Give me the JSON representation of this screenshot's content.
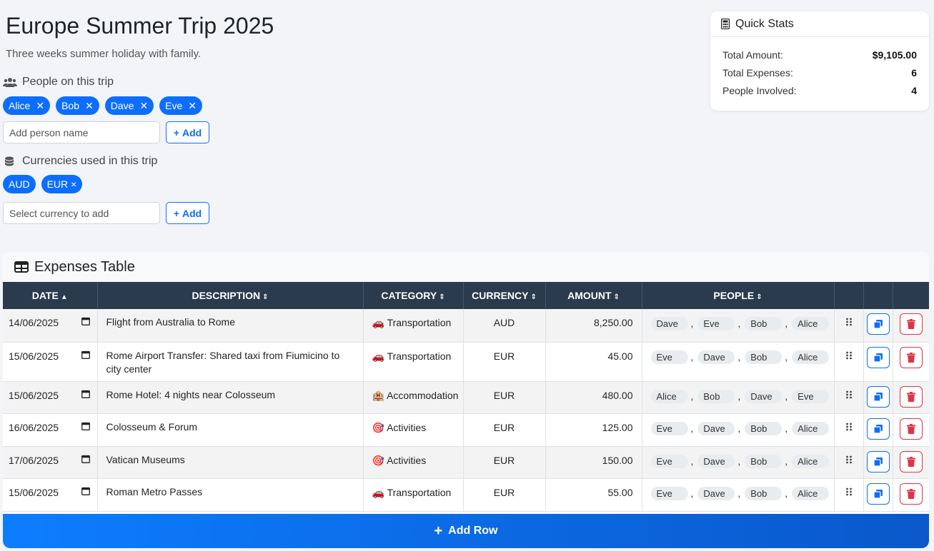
{
  "trip": {
    "title": "Europe Summer Trip 2025",
    "subtitle": "Three weeks summer holiday with family."
  },
  "people_section": {
    "label": "People on this trip",
    "people": [
      "Alice",
      "Bob",
      "Dave",
      "Eve"
    ],
    "input_placeholder": "Add person name",
    "add_label": "Add"
  },
  "currency_section": {
    "label": "Currencies used in this trip",
    "currencies": [
      "AUD",
      "EUR"
    ],
    "input_placeholder": "Select currency to add",
    "add_label": "Add"
  },
  "stats": {
    "title": "Quick Stats",
    "rows": [
      {
        "label": "Total Amount:",
        "value": "$9,105.00"
      },
      {
        "label": "Total Expenses:",
        "value": "6"
      },
      {
        "label": "People Involved:",
        "value": "4"
      }
    ]
  },
  "table": {
    "title": "Expenses Table",
    "headers": {
      "date": "DATE",
      "description": "DESCRIPTION",
      "category": "CATEGORY",
      "currency": "CURRENCY",
      "amount": "AMOUNT",
      "people": "PEOPLE"
    },
    "rows": [
      {
        "date": "14/06/2025",
        "description": "Flight from Australia to Rome",
        "category_icon": "🚗",
        "category": "Transportation",
        "currency": "AUD",
        "amount": "8,250.00",
        "people": [
          "Dave",
          "Eve",
          "Bob",
          "Alice"
        ]
      },
      {
        "date": "15/06/2025",
        "description": "Rome Airport Transfer: Shared taxi from Fiumicino to city center",
        "category_icon": "🚗",
        "category": "Transportation",
        "currency": "EUR",
        "amount": "45.00",
        "people": [
          "Eve",
          "Dave",
          "Bob",
          "Alice"
        ]
      },
      {
        "date": "15/06/2025",
        "description": "Rome Hotel: 4 nights near Colosseum",
        "category_icon": "🏨",
        "category": "Accommodation",
        "currency": "EUR",
        "amount": "480.00",
        "people": [
          "Alice",
          "Bob",
          "Dave",
          "Eve"
        ]
      },
      {
        "date": "16/06/2025",
        "description": "Colosseum & Forum",
        "category_icon": "🎯",
        "category": "Activities",
        "currency": "EUR",
        "amount": "125.00",
        "people": [
          "Eve",
          "Dave",
          "Bob",
          "Alice"
        ]
      },
      {
        "date": "17/06/2025",
        "description": "Vatican Museums",
        "category_icon": "🎯",
        "category": "Activities",
        "currency": "EUR",
        "amount": "150.00",
        "people": [
          "Eve",
          "Dave",
          "Bob",
          "Alice"
        ]
      },
      {
        "date": "15/06/2025",
        "description": "Roman Metro Passes",
        "category_icon": "🚗",
        "category": "Transportation",
        "currency": "EUR",
        "amount": "55.00",
        "people": [
          "Eve",
          "Dave",
          "Bob",
          "Alice"
        ]
      }
    ],
    "add_row_label": "Add Row"
  },
  "colors": {
    "primary": "#0d6efd",
    "header_bg": "#2b3b4e",
    "danger": "#dc3545"
  }
}
